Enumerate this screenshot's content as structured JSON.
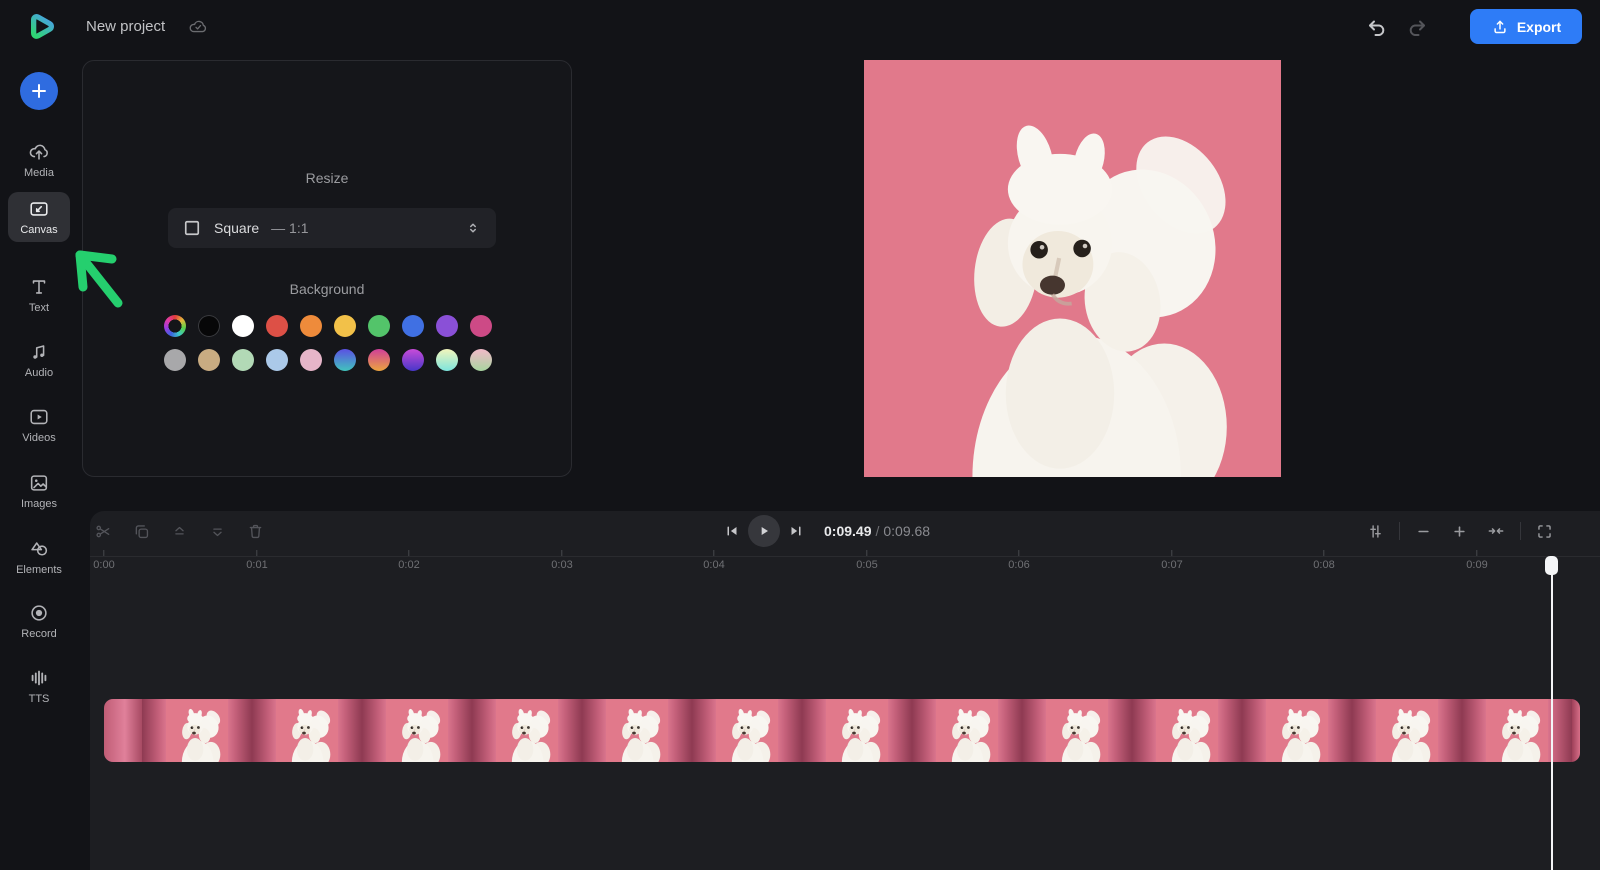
{
  "app": {
    "title": "New project",
    "logo_icon": "clipchamp-play-logo",
    "save_status_icon": "cloud-check-icon"
  },
  "topbar": {
    "undo_icon": "undo-icon",
    "redo_icon": "redo-icon",
    "export_button": {
      "label": "Export",
      "icon": "upload-icon",
      "color": "#2e7cf7"
    }
  },
  "sidebar": {
    "add_button_icon": "plus-icon",
    "add_button_color": "#2f6ce0",
    "items": [
      {
        "label": "Media",
        "icon": "cloud-upload-icon",
        "selected": false
      },
      {
        "label": "Canvas",
        "icon": "canvas-resize-icon",
        "selected": true
      },
      {
        "label": "Text",
        "icon": "text-icon",
        "selected": false
      },
      {
        "label": "Audio",
        "icon": "music-note-icon",
        "selected": false
      },
      {
        "label": "Videos",
        "icon": "video-play-icon",
        "selected": false
      },
      {
        "label": "Images",
        "icon": "image-icon",
        "selected": false
      },
      {
        "label": "Elements",
        "icon": "shapes-icon",
        "selected": false
      },
      {
        "label": "Record",
        "icon": "record-icon",
        "selected": false
      },
      {
        "label": "TTS",
        "icon": "waveform-icon",
        "selected": false
      }
    ]
  },
  "canvas_panel": {
    "resize_title": "Resize",
    "background_title": "Background",
    "aspect_dropdown": {
      "icon": "square-aspect-icon",
      "value": "Square",
      "ratio_suffix": "— 1:1",
      "chevron_icon": "chevron-updown-icon"
    },
    "swatches": [
      {
        "name": "color-wheel",
        "style": "background:radial-gradient(circle,#141519 0 6.5px,rgba(0,0,0,0) 6.5px),conic-gradient(#e23c3c,#e2b93c,#59d148,#3cc8c8,#3b63e0,#9b3be0,#e03ba8,#e23c3c)"
      },
      {
        "name": "black",
        "style": "background:#070708;box-shadow:inset 0 0 0 1px #3b3c40"
      },
      {
        "name": "white",
        "style": "background:#ffffff"
      },
      {
        "name": "red",
        "style": "background:#dd5046"
      },
      {
        "name": "orange",
        "style": "background:#ee8b3b"
      },
      {
        "name": "yellow",
        "style": "background:#f2c149"
      },
      {
        "name": "green",
        "style": "background:#53c46a"
      },
      {
        "name": "blue",
        "style": "background:#4070e3"
      },
      {
        "name": "purple",
        "style": "background:#8a50d7"
      },
      {
        "name": "magenta",
        "style": "background:#cd4a86"
      },
      {
        "name": "gray",
        "style": "background:#a8a8aa"
      },
      {
        "name": "tan",
        "style": "background:#c9ac82"
      },
      {
        "name": "light-green",
        "style": "background:#b2d9b6"
      },
      {
        "name": "light-blue",
        "style": "background:#abc9e9"
      },
      {
        "name": "light-pink",
        "style": "background:#e6b5c9"
      },
      {
        "name": "blue-teal-gradient",
        "style": "background:linear-gradient(180deg,#5b50e3,#41c4bd)"
      },
      {
        "name": "pink-orange-gradient",
        "style": "background:linear-gradient(180deg,#cf3f99,#eba43f)"
      },
      {
        "name": "magenta-blue-gradient",
        "style": "background:linear-gradient(180deg,#c94bd9,#4737c9)"
      },
      {
        "name": "yellow-cyan-gradient",
        "style": "background:linear-gradient(180deg,#f2f5bb,#7de5dd)"
      },
      {
        "name": "pink-green-gradient",
        "style": "background:linear-gradient(180deg,#f1b9c9,#a8d5a0)"
      }
    ]
  },
  "annotation": {
    "type": "arrow",
    "color": "#25cf6e",
    "points_to": "Canvas"
  },
  "preview": {
    "background_color": "#e1798b",
    "subject": "White poodle dog on pink backdrop"
  },
  "timeline": {
    "clip_tools": [
      "split-icon",
      "duplicate-icon",
      "bring-forward-icon",
      "send-backward-icon",
      "delete-icon"
    ],
    "transport": {
      "skip_back_icon": "skip-to-start-icon",
      "play_icon": "play-icon",
      "skip_forward_icon": "skip-to-end-icon"
    },
    "time": {
      "current": "0:09.49",
      "separator": "/",
      "total": "0:09.68"
    },
    "view_tools": [
      "timeline-settings-icon",
      "zoom-out-icon",
      "zoom-in-icon",
      "zoom-to-fit-icon",
      "fullscreen-icon"
    ],
    "ruler": [
      "0:00",
      "0:01",
      "0:02",
      "0:03",
      "0:04",
      "0:05",
      "0:06",
      "0:07",
      "0:08",
      "0:09"
    ],
    "clip": {
      "type": "video",
      "subject": "poodle on pink",
      "thumbnail_count": 13,
      "start": "0:00",
      "end": "0:09.68"
    }
  }
}
